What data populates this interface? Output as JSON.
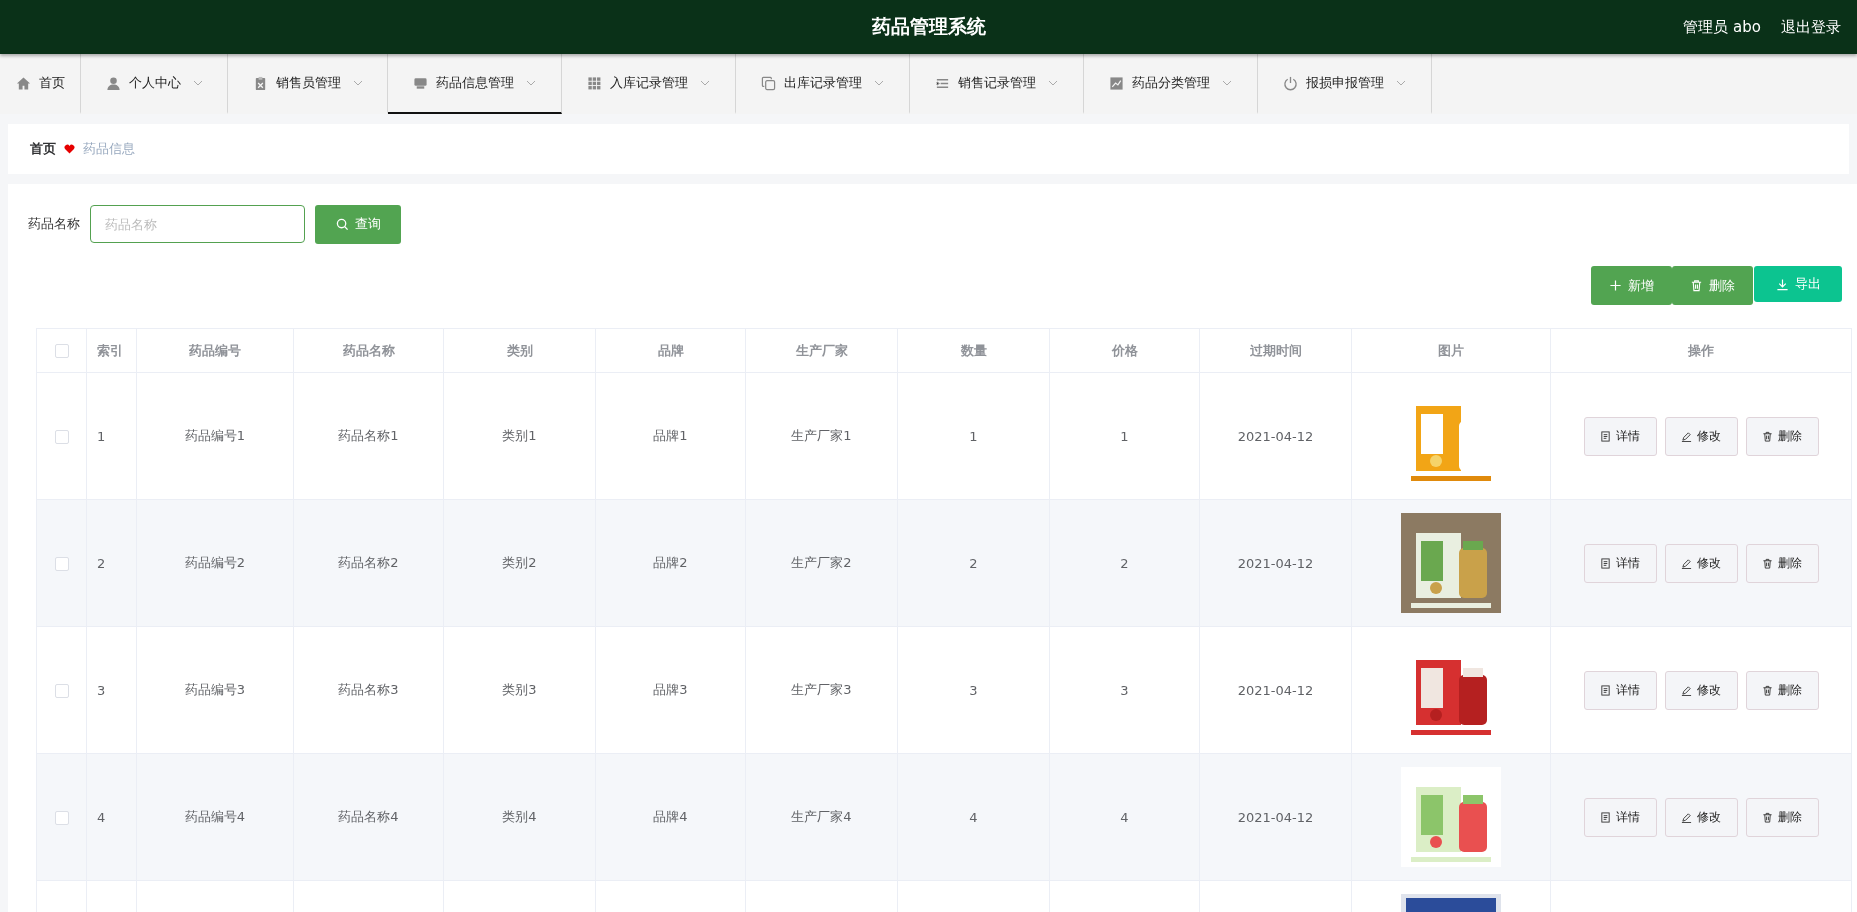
{
  "header": {
    "title": "药品管理系统",
    "user": "管理员 abo",
    "logout": "退出登录"
  },
  "nav": [
    {
      "label": "首页",
      "selected": false,
      "has_menu": false
    },
    {
      "label": "个人中心",
      "selected": false,
      "has_menu": true
    },
    {
      "label": "销售员管理",
      "selected": false,
      "has_menu": true
    },
    {
      "label": "药品信息管理",
      "selected": true,
      "has_menu": true
    },
    {
      "label": "入库记录管理",
      "selected": false,
      "has_menu": true
    },
    {
      "label": "出库记录管理",
      "selected": false,
      "has_menu": true
    },
    {
      "label": "销售记录管理",
      "selected": false,
      "has_menu": true
    },
    {
      "label": "药品分类管理",
      "selected": false,
      "has_menu": true
    },
    {
      "label": "报损申报管理",
      "selected": false,
      "has_menu": true
    }
  ],
  "breadcrumb": {
    "home": "首页",
    "current": "药品信息"
  },
  "search": {
    "label": "药品名称",
    "placeholder": "药品名称",
    "button": "查询"
  },
  "toolbar": {
    "add": "新增",
    "delete": "删除",
    "export": "导出"
  },
  "table": {
    "columns": [
      "索引",
      "药品编号",
      "药品名称",
      "类别",
      "品牌",
      "生产厂家",
      "数量",
      "价格",
      "过期时间",
      "图片",
      "操作"
    ],
    "header_checked": false,
    "rows": [
      {
        "checked": false,
        "cells": [
          "1",
          "药品编号1",
          "药品名称1",
          "类别1",
          "品牌1",
          "生产厂家1",
          "1",
          "1",
          "2021-04-12"
        ],
        "image": {
          "kind": "picture"
        },
        "actions": [
          "详情",
          "修改",
          "删除"
        ]
      },
      {
        "checked": false,
        "cells": [
          "2",
          "药品编号2",
          "药品名称2",
          "类别2",
          "品牌2",
          "生产厂家2",
          "2",
          "2",
          "2021-04-12"
        ],
        "image": {
          "kind": "picture"
        },
        "actions": [
          "详情",
          "修改",
          "删除"
        ]
      },
      {
        "checked": false,
        "cells": [
          "3",
          "药品编号3",
          "药品名称3",
          "类别3",
          "品牌3",
          "生产厂家3",
          "3",
          "3",
          "2021-04-12"
        ],
        "image": {
          "kind": "picture"
        },
        "actions": [
          "详情",
          "修改",
          "删除"
        ]
      },
      {
        "checked": false,
        "cells": [
          "4",
          "药品编号4",
          "药品名称4",
          "类别4",
          "品牌4",
          "生产厂家4",
          "4",
          "4",
          "2021-04-12"
        ],
        "image": {
          "kind": "picture"
        },
        "actions": [
          "详情",
          "修改",
          "删除"
        ]
      },
      {
        "image": {
          "kind": "picture"
        }
      }
    ]
  }
}
